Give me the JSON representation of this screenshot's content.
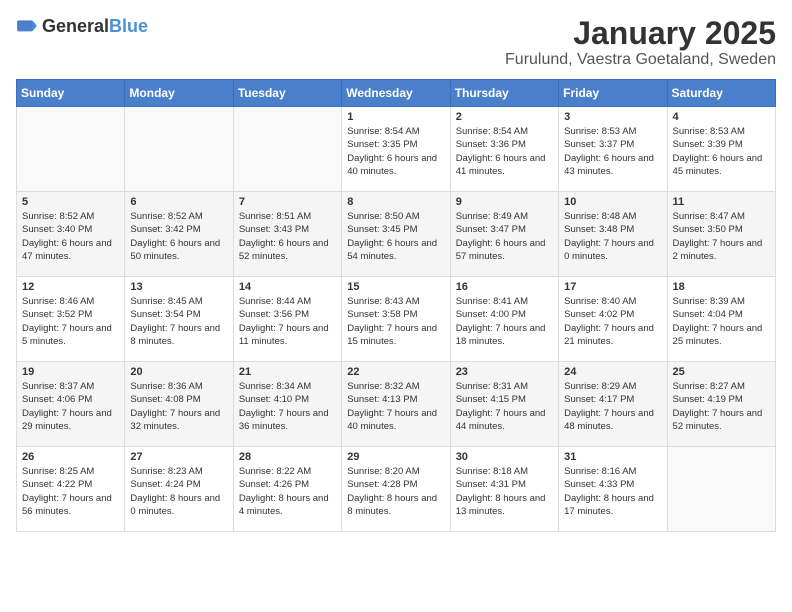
{
  "header": {
    "logo_general": "General",
    "logo_blue": "Blue",
    "month": "January 2025",
    "location": "Furulund, Vaestra Goetaland, Sweden"
  },
  "weekdays": [
    "Sunday",
    "Monday",
    "Tuesday",
    "Wednesday",
    "Thursday",
    "Friday",
    "Saturday"
  ],
  "weeks": [
    [
      {
        "day": "",
        "sunrise": "",
        "sunset": "",
        "daylight": ""
      },
      {
        "day": "",
        "sunrise": "",
        "sunset": "",
        "daylight": ""
      },
      {
        "day": "",
        "sunrise": "",
        "sunset": "",
        "daylight": ""
      },
      {
        "day": "1",
        "sunrise": "Sunrise: 8:54 AM",
        "sunset": "Sunset: 3:35 PM",
        "daylight": "Daylight: 6 hours and 40 minutes."
      },
      {
        "day": "2",
        "sunrise": "Sunrise: 8:54 AM",
        "sunset": "Sunset: 3:36 PM",
        "daylight": "Daylight: 6 hours and 41 minutes."
      },
      {
        "day": "3",
        "sunrise": "Sunrise: 8:53 AM",
        "sunset": "Sunset: 3:37 PM",
        "daylight": "Daylight: 6 hours and 43 minutes."
      },
      {
        "day": "4",
        "sunrise": "Sunrise: 8:53 AM",
        "sunset": "Sunset: 3:39 PM",
        "daylight": "Daylight: 6 hours and 45 minutes."
      }
    ],
    [
      {
        "day": "5",
        "sunrise": "Sunrise: 8:52 AM",
        "sunset": "Sunset: 3:40 PM",
        "daylight": "Daylight: 6 hours and 47 minutes."
      },
      {
        "day": "6",
        "sunrise": "Sunrise: 8:52 AM",
        "sunset": "Sunset: 3:42 PM",
        "daylight": "Daylight: 6 hours and 50 minutes."
      },
      {
        "day": "7",
        "sunrise": "Sunrise: 8:51 AM",
        "sunset": "Sunset: 3:43 PM",
        "daylight": "Daylight: 6 hours and 52 minutes."
      },
      {
        "day": "8",
        "sunrise": "Sunrise: 8:50 AM",
        "sunset": "Sunset: 3:45 PM",
        "daylight": "Daylight: 6 hours and 54 minutes."
      },
      {
        "day": "9",
        "sunrise": "Sunrise: 8:49 AM",
        "sunset": "Sunset: 3:47 PM",
        "daylight": "Daylight: 6 hours and 57 minutes."
      },
      {
        "day": "10",
        "sunrise": "Sunrise: 8:48 AM",
        "sunset": "Sunset: 3:48 PM",
        "daylight": "Daylight: 7 hours and 0 minutes."
      },
      {
        "day": "11",
        "sunrise": "Sunrise: 8:47 AM",
        "sunset": "Sunset: 3:50 PM",
        "daylight": "Daylight: 7 hours and 2 minutes."
      }
    ],
    [
      {
        "day": "12",
        "sunrise": "Sunrise: 8:46 AM",
        "sunset": "Sunset: 3:52 PM",
        "daylight": "Daylight: 7 hours and 5 minutes."
      },
      {
        "day": "13",
        "sunrise": "Sunrise: 8:45 AM",
        "sunset": "Sunset: 3:54 PM",
        "daylight": "Daylight: 7 hours and 8 minutes."
      },
      {
        "day": "14",
        "sunrise": "Sunrise: 8:44 AM",
        "sunset": "Sunset: 3:56 PM",
        "daylight": "Daylight: 7 hours and 11 minutes."
      },
      {
        "day": "15",
        "sunrise": "Sunrise: 8:43 AM",
        "sunset": "Sunset: 3:58 PM",
        "daylight": "Daylight: 7 hours and 15 minutes."
      },
      {
        "day": "16",
        "sunrise": "Sunrise: 8:41 AM",
        "sunset": "Sunset: 4:00 PM",
        "daylight": "Daylight: 7 hours and 18 minutes."
      },
      {
        "day": "17",
        "sunrise": "Sunrise: 8:40 AM",
        "sunset": "Sunset: 4:02 PM",
        "daylight": "Daylight: 7 hours and 21 minutes."
      },
      {
        "day": "18",
        "sunrise": "Sunrise: 8:39 AM",
        "sunset": "Sunset: 4:04 PM",
        "daylight": "Daylight: 7 hours and 25 minutes."
      }
    ],
    [
      {
        "day": "19",
        "sunrise": "Sunrise: 8:37 AM",
        "sunset": "Sunset: 4:06 PM",
        "daylight": "Daylight: 7 hours and 29 minutes."
      },
      {
        "day": "20",
        "sunrise": "Sunrise: 8:36 AM",
        "sunset": "Sunset: 4:08 PM",
        "daylight": "Daylight: 7 hours and 32 minutes."
      },
      {
        "day": "21",
        "sunrise": "Sunrise: 8:34 AM",
        "sunset": "Sunset: 4:10 PM",
        "daylight": "Daylight: 7 hours and 36 minutes."
      },
      {
        "day": "22",
        "sunrise": "Sunrise: 8:32 AM",
        "sunset": "Sunset: 4:13 PM",
        "daylight": "Daylight: 7 hours and 40 minutes."
      },
      {
        "day": "23",
        "sunrise": "Sunrise: 8:31 AM",
        "sunset": "Sunset: 4:15 PM",
        "daylight": "Daylight: 7 hours and 44 minutes."
      },
      {
        "day": "24",
        "sunrise": "Sunrise: 8:29 AM",
        "sunset": "Sunset: 4:17 PM",
        "daylight": "Daylight: 7 hours and 48 minutes."
      },
      {
        "day": "25",
        "sunrise": "Sunrise: 8:27 AM",
        "sunset": "Sunset: 4:19 PM",
        "daylight": "Daylight: 7 hours and 52 minutes."
      }
    ],
    [
      {
        "day": "26",
        "sunrise": "Sunrise: 8:25 AM",
        "sunset": "Sunset: 4:22 PM",
        "daylight": "Daylight: 7 hours and 56 minutes."
      },
      {
        "day": "27",
        "sunrise": "Sunrise: 8:23 AM",
        "sunset": "Sunset: 4:24 PM",
        "daylight": "Daylight: 8 hours and 0 minutes."
      },
      {
        "day": "28",
        "sunrise": "Sunrise: 8:22 AM",
        "sunset": "Sunset: 4:26 PM",
        "daylight": "Daylight: 8 hours and 4 minutes."
      },
      {
        "day": "29",
        "sunrise": "Sunrise: 8:20 AM",
        "sunset": "Sunset: 4:28 PM",
        "daylight": "Daylight: 8 hours and 8 minutes."
      },
      {
        "day": "30",
        "sunrise": "Sunrise: 8:18 AM",
        "sunset": "Sunset: 4:31 PM",
        "daylight": "Daylight: 8 hours and 13 minutes."
      },
      {
        "day": "31",
        "sunrise": "Sunrise: 8:16 AM",
        "sunset": "Sunset: 4:33 PM",
        "daylight": "Daylight: 8 hours and 17 minutes."
      },
      {
        "day": "",
        "sunrise": "",
        "sunset": "",
        "daylight": ""
      }
    ]
  ]
}
